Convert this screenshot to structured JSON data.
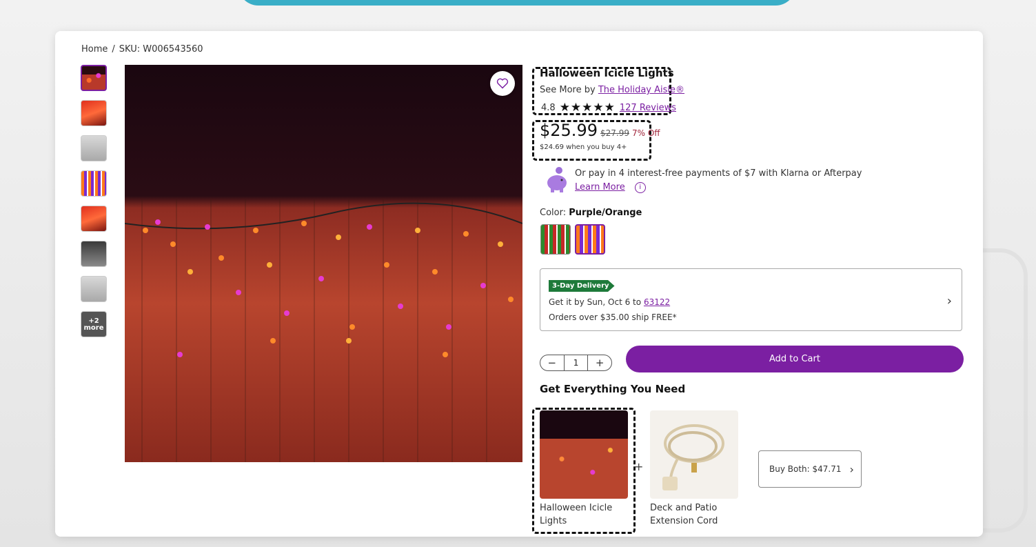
{
  "breadcrumb": {
    "home": "Home",
    "separator": "/",
    "sku": "SKU: W006543560"
  },
  "thumbnails": {
    "more_count": "+2",
    "more_label": "more"
  },
  "product": {
    "title": "Halloween Icicle Lights",
    "see_more_prefix": "See More by",
    "brand": "The Holiday Aisle®",
    "rating_value": "4.8",
    "rating_stars": "★★★★★",
    "reviews": "127 Reviews",
    "price": "$25.99",
    "original_price": "$27.99",
    "discount": "7% Off",
    "bulk_price": "$24.69 when you buy 4+"
  },
  "klarna": {
    "text": "Or pay in 4 interest-free payments of $7 with Klarna or Afterpay",
    "learn_more": "Learn More",
    "info_icon": "i"
  },
  "color": {
    "label": "Color:",
    "selected": "Purple/Orange"
  },
  "delivery": {
    "badge": "3-Day Delivery",
    "get_it_prefix": "Get it by Sun, Oct 6 to",
    "zip": "63122",
    "free_ship": "Orders over $35.00 ship FREE*"
  },
  "quantity": {
    "minus": "−",
    "value": "1",
    "plus": "+"
  },
  "add_to_cart": "Add to Cart",
  "bundle": {
    "title": "Get Everything You Need",
    "item1": "Halloween Icicle Lights",
    "plus": "+",
    "item2": "Deck and Patio Extension Cord",
    "buy_both": "Buy Both: $47.71"
  },
  "colors": {
    "accent": "#7b1fa2",
    "delivery_badge": "#1e7a3a",
    "discount": "#a0243a",
    "banner": "#3aaec7"
  }
}
